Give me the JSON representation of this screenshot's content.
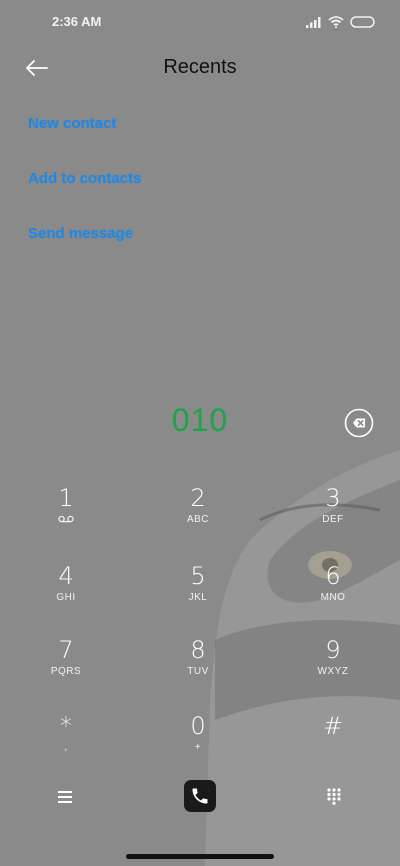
{
  "status_bar": {
    "time": "2:36 AM"
  },
  "header": {
    "title": "Recents"
  },
  "actions": [
    {
      "label": "New contact"
    },
    {
      "label": "Add to contacts"
    },
    {
      "label": "Send message"
    }
  ],
  "dialer": {
    "number": "010"
  },
  "keypad": [
    {
      "digit": "1",
      "letters": ""
    },
    {
      "digit": "2",
      "letters": "ABC"
    },
    {
      "digit": "3",
      "letters": "DEF"
    },
    {
      "digit": "4",
      "letters": "GHI"
    },
    {
      "digit": "5",
      "letters": "JKL"
    },
    {
      "digit": "6",
      "letters": "MNO"
    },
    {
      "digit": "7",
      "letters": "PQRS"
    },
    {
      "digit": "8",
      "letters": "TUV"
    },
    {
      "digit": "9",
      "letters": "WXYZ"
    },
    {
      "digit": "*",
      "letters": ","
    },
    {
      "digit": "0",
      "letters": "+"
    },
    {
      "digit": "#",
      "letters": ""
    }
  ],
  "icons": {
    "back": "back-arrow-icon",
    "delete": "backspace-icon",
    "voicemail": "voicemail-icon",
    "menu": "menu-icon",
    "call": "phone-icon",
    "dialpad": "dialpad-icon"
  },
  "colors": {
    "background": "#8a8a8a",
    "link": "#1e88e5",
    "number": "#1ea34a",
    "call_button": "#1a1a1a"
  }
}
